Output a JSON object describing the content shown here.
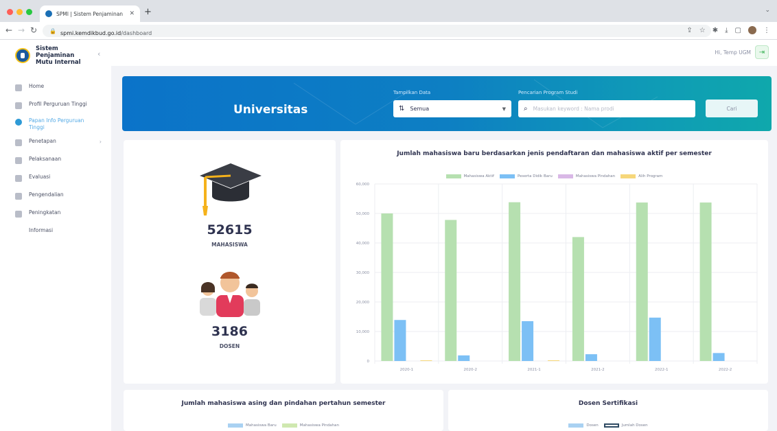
{
  "browser": {
    "tab_title": "SPMI | Sistem Penjaminan Mu",
    "url_host": "spmi.kemdikbud.go.id",
    "url_path": "/dashboard"
  },
  "sidebar": {
    "brand_line1": "Sistem Penjaminan",
    "brand_line2": "Mutu Internal",
    "items": [
      {
        "label": "Home",
        "icon": "home-icon"
      },
      {
        "label": "Profil Perguruan Tinggi",
        "icon": "profile-icon"
      },
      {
        "label": "Papan Info Perguruan Tinggi",
        "icon": "info-board-icon",
        "active": true
      },
      {
        "label": "Penetapan",
        "icon": "document-icon",
        "has_submenu": true
      },
      {
        "label": "Pelaksanaan",
        "icon": "execution-icon"
      },
      {
        "label": "Evaluasi",
        "icon": "evaluation-icon"
      },
      {
        "label": "Pengendalian",
        "icon": "control-icon"
      },
      {
        "label": "Peningkatan",
        "icon": "chart-up-icon"
      },
      {
        "label": "Informasi",
        "icon": ""
      }
    ]
  },
  "header": {
    "greeting": "Hi, Temp UGM"
  },
  "banner": {
    "title": "Universitas",
    "data_label": "Tampilkan Data",
    "data_value": "Semua",
    "search_label": "Pencarian Program Studi",
    "search_placeholder": "Masukan keyword : Nama prodi",
    "search_button": "Cari"
  },
  "stats": {
    "students_count": "52615",
    "students_label": "MAHASISWA",
    "lecturers_count": "3186",
    "lecturers_label": "DOSEN"
  },
  "colors": {
    "accent": "#0b73c9",
    "aktif": "#b6e0b0",
    "baru": "#7cc0f5",
    "pindahan": "#d9b8e6",
    "alih": "#f6d77a"
  },
  "chart_data": [
    {
      "type": "bar",
      "title": "Jumlah mahasiswa baru berdasarkan jenis pendaftaran dan mahasiswa aktif per semester",
      "categories": [
        "2020-1",
        "2020-2",
        "2021-1",
        "2021-2",
        "2022-1",
        "2022-2"
      ],
      "series": [
        {
          "name": "Mahasiswa Aktif",
          "values": [
            50000,
            47800,
            53800,
            42000,
            53700,
            53700
          ]
        },
        {
          "name": "Peserta Didik Baru",
          "values": [
            13900,
            1900,
            13500,
            2300,
            14700,
            2700
          ]
        },
        {
          "name": "Mahasiswa Pindahan",
          "values": [
            0,
            0,
            0,
            0,
            0,
            0
          ]
        },
        {
          "name": "Alih Program",
          "values": [
            200,
            0,
            250,
            0,
            0,
            0
          ]
        }
      ],
      "ylim": [
        0,
        60000
      ],
      "yticks": [
        "0",
        "10,000",
        "20,000",
        "30,000",
        "40,000",
        "50,000",
        "60,000"
      ],
      "grid": true,
      "legend": "top-center"
    },
    {
      "type": "bar",
      "title": "Jumlah mahasiswa asing dan pindahan pertahun semester",
      "series": [
        {
          "name": "Mahasiswa Baru"
        },
        {
          "name": "Mahasiswa Pindahan"
        }
      ],
      "legend": "top-center"
    },
    {
      "type": "bar",
      "title": "Dosen Sertifikasi",
      "series": [
        {
          "name": "Dosen"
        },
        {
          "name": "Jumlah Dosen"
        }
      ],
      "legend": "top-center"
    }
  ]
}
